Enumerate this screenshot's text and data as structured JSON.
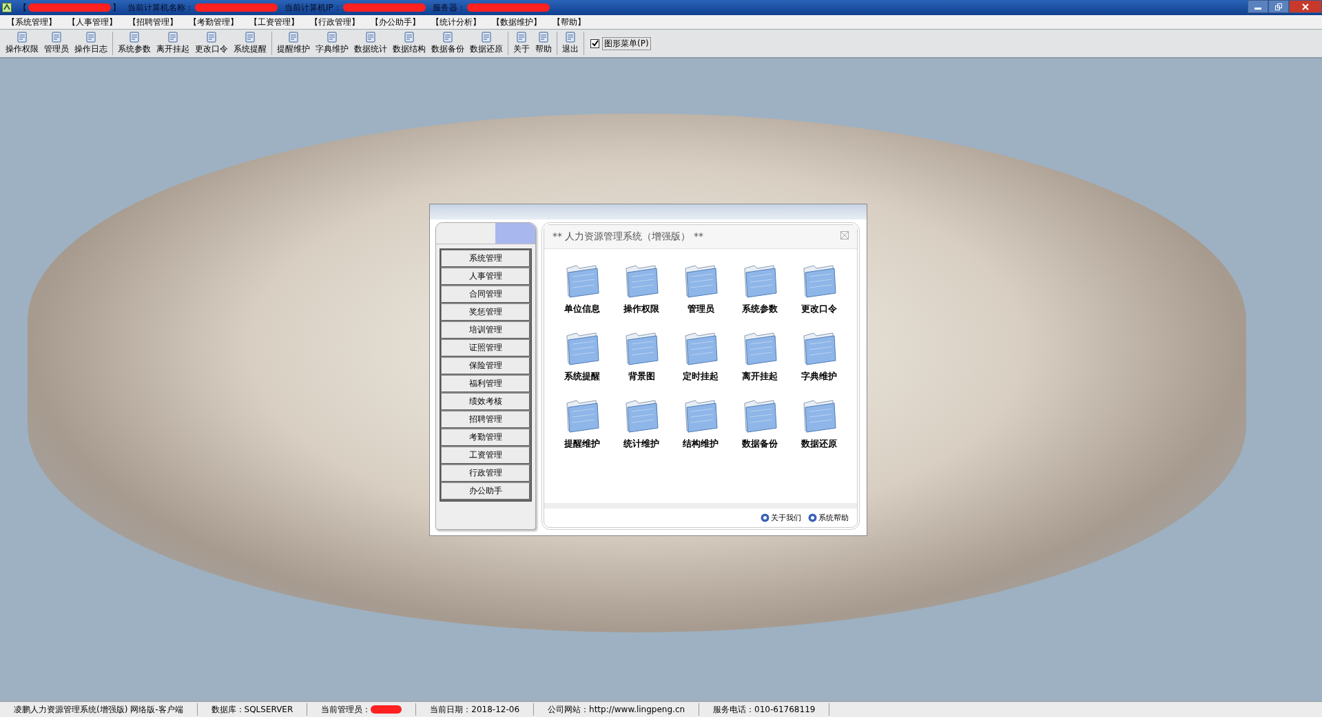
{
  "title_bar": {
    "segments": [
      {
        "label": "【",
        "redacted": true,
        "suffix": "】"
      },
      {
        "label": "当前计算机名称：",
        "redacted": true
      },
      {
        "label": "当前计算机IP：",
        "redacted": true
      },
      {
        "label": "服务器：",
        "redacted": true
      }
    ]
  },
  "menu_bar": [
    "【系统管理】",
    "【人事管理】",
    "【招聘管理】",
    "【考勤管理】",
    "【工资管理】",
    "【行政管理】",
    "【办公助手】",
    "【统计分析】",
    "【数据维护】",
    "【帮助】"
  ],
  "toolbar": {
    "groups": [
      [
        "操作权限",
        "管理员",
        "操作日志"
      ],
      [
        "系统参数",
        "离开挂起",
        "更改口令",
        "系统提醒"
      ],
      [
        "提醒维护",
        "字典维护",
        "数据统计",
        "数据结构",
        "数据备份",
        "数据还原"
      ],
      [
        "关于",
        "帮助"
      ],
      [
        "退出"
      ]
    ],
    "graphic_menu": {
      "label": "图形菜单(P)",
      "checked": true
    }
  },
  "dialog": {
    "title": "** 人力资源管理系统（增强版） **",
    "side_menu": [
      "系统管理",
      "人事管理",
      "合同管理",
      "奖惩管理",
      "培训管理",
      "证照管理",
      "保险管理",
      "福利管理",
      "绩效考核",
      "招聘管理",
      "考勤管理",
      "工资管理",
      "行政管理",
      "办公助手"
    ],
    "tiles": [
      "单位信息",
      "操作权限",
      "管理员",
      "系统参数",
      "更改口令",
      "系统提醒",
      "背景图",
      "定时挂起",
      "离开挂起",
      "字典维护",
      "提醒维护",
      "统计维护",
      "结构维护",
      "数据备份",
      "数据还原"
    ],
    "footer_links": [
      "关于我们",
      "系统帮助"
    ]
  },
  "status_bar": [
    {
      "label": "凌鹏人力资源管理系统(增强版) 网络版-客户端",
      "redacted": false
    },
    {
      "label": "数据库：SQLSERVER",
      "redacted": false
    },
    {
      "label": "当前管理员：",
      "redacted": true
    },
    {
      "label": "当前日期：2018-12-06",
      "redacted": false
    },
    {
      "label": "公司网站：http://www.lingpeng.cn",
      "redacted": false
    },
    {
      "label": "服务电话：010-61768119",
      "redacted": false
    }
  ]
}
